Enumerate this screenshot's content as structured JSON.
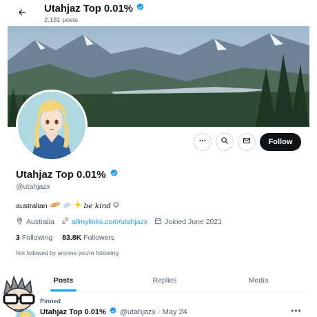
{
  "header": {
    "title": "Utahjaz Top 0.01%",
    "posts_count": "2,181 posts"
  },
  "profile": {
    "name": "Utahjaz Top 0.01%",
    "handle": "@utahjazx",
    "bio_text": "australian",
    "bio_fancy": "be kind",
    "location": "Australia",
    "link": "allmylinks.com/utahjazx",
    "joined": "Joined June 2021",
    "following_count": "3",
    "following_label": "Following",
    "followers_count": "83.8K",
    "followers_label": "Followers",
    "not_followed": "Not followed by anyone you're following"
  },
  "actions": {
    "follow_label": "Follow"
  },
  "tabs": [
    {
      "label": "Posts",
      "active": true
    },
    {
      "label": "Replies",
      "active": false
    },
    {
      "label": "Media",
      "active": false
    }
  ],
  "pinned_tweet": {
    "pinned_label": "Pinned",
    "name": "Utahjaz Top 0.01%",
    "handle_time": "@utahjazx · May 24"
  },
  "colors": {
    "accent": "#1d9bf0",
    "text": "#0f1419",
    "muted": "#536471",
    "follow_bg": "#0f1419"
  },
  "icons": [
    "back-arrow-icon",
    "verified-badge-icon",
    "more-icon",
    "search-icon",
    "mail-icon",
    "location-icon",
    "link-icon",
    "calendar-icon",
    "pin-icon"
  ]
}
